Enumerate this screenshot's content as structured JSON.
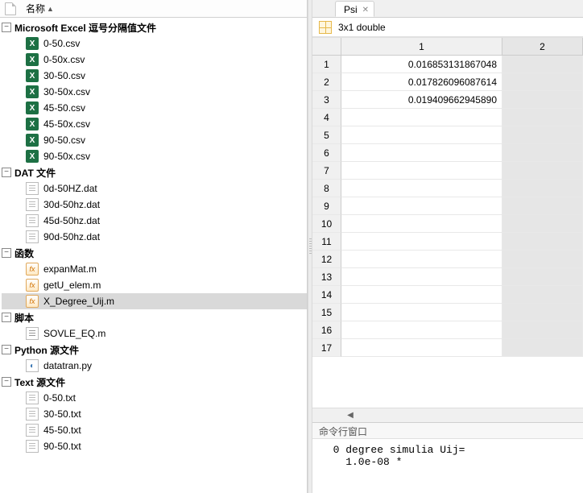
{
  "left": {
    "header": {
      "column_label": "名称",
      "sort": "▲"
    },
    "groups": [
      {
        "label": "Microsoft Excel 逗号分隔值文件",
        "icon": "excel",
        "items": [
          "0-50.csv",
          "0-50x.csv",
          "30-50.csv",
          "30-50x.csv",
          "45-50.csv",
          "45-50x.csv",
          "90-50.csv",
          "90-50x.csv"
        ]
      },
      {
        "label": "DAT 文件",
        "icon": "txt",
        "items": [
          "0d-50HZ.dat",
          "30d-50hz.dat",
          "45d-50hz.dat",
          "90d-50hz.dat"
        ]
      },
      {
        "label": "函数",
        "icon": "m",
        "items": [
          "expanMat.m",
          "getU_elem.m",
          "X_Degree_Uij.m"
        ],
        "selected": "X_Degree_Uij.m"
      },
      {
        "label": "脚本",
        "icon": "script",
        "items": [
          "SOVLE_EQ.m"
        ]
      },
      {
        "label": "Python 源文件",
        "icon": "py",
        "items": [
          "datatran.py"
        ]
      },
      {
        "label": "Text 源文件",
        "icon": "txt",
        "items": [
          "0-50.txt",
          "30-50.txt",
          "45-50.txt",
          "90-50.txt"
        ]
      }
    ]
  },
  "right": {
    "tab": {
      "label": "Psi"
    },
    "var_type": "3x1 double",
    "columns": [
      "1",
      "2"
    ],
    "rows": [
      {
        "n": "1",
        "v": "0.016853131867048"
      },
      {
        "n": "2",
        "v": "0.017826096087614"
      },
      {
        "n": "3",
        "v": "0.019409662945890"
      },
      {
        "n": "4",
        "v": ""
      },
      {
        "n": "5",
        "v": ""
      },
      {
        "n": "6",
        "v": ""
      },
      {
        "n": "7",
        "v": ""
      },
      {
        "n": "8",
        "v": ""
      },
      {
        "n": "9",
        "v": ""
      },
      {
        "n": "10",
        "v": ""
      },
      {
        "n": "11",
        "v": ""
      },
      {
        "n": "12",
        "v": ""
      },
      {
        "n": "13",
        "v": ""
      },
      {
        "n": "14",
        "v": ""
      },
      {
        "n": "15",
        "v": ""
      },
      {
        "n": "16",
        "v": ""
      },
      {
        "n": "17",
        "v": ""
      }
    ],
    "cmd": {
      "title": "命令行窗口",
      "lines": [
        "  0 degree simulia Uij=",
        "    1.0e-08 *"
      ]
    }
  }
}
